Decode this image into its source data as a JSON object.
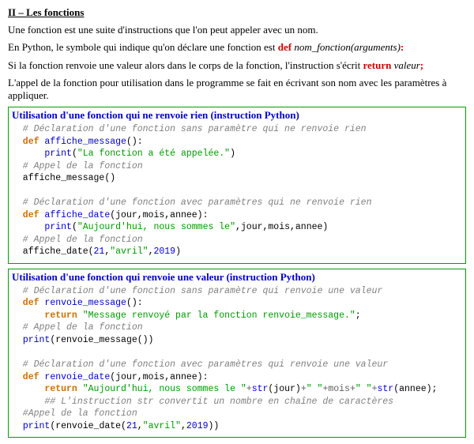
{
  "heading": "II – Les fonctions",
  "para1": "Une fonction est une suite d'instructions que l'on peut appeler avec un nom.",
  "para2_pre": "En Python, le symbole qui indique qu'on déclare une fonction est ",
  "para2_def": "def",
  "para2_sig": " nom_fonction",
  "para2_args": "(arguments)",
  "para2_colon": ":",
  "para3_pre": "Si la fonction renvoie une valeur alors dans le corps de la fonction, l'instruction s'écrit ",
  "para3_ret": "return",
  "para3_val": " valeur",
  "para3_semi": ";",
  "para4": "L'appel de la fonction pour utilisation dans le programme se fait en écrivant son nom avec les paramètres à appliquer.",
  "box1": {
    "title": "Utilisation d'une fonction qui ne renvoie rien (instruction Python)",
    "c1": "  # Déclaration d'une fonction sans paramètre qui ne renvoie rien",
    "l2_def": "  def ",
    "l2_name": "affiche_message",
    "l2_rest": "():",
    "l3_ind": "      ",
    "l3_fn": "print",
    "l3_op": "(",
    "l3_str": "\"La fonction a été appelée.\"",
    "l3_cl": ")",
    "c4": "  # Appel de la fonction",
    "l5": "  affiche_message()",
    "blank1": "",
    "c6": "  # Déclaration d'une fonction avec paramètres qui ne renvoie rien",
    "l7_def": "  def ",
    "l7_name": "affiche_date",
    "l7_rest": "(jour,mois,annee):",
    "l8_ind": "      ",
    "l8_fn": "print",
    "l8_op": "(",
    "l8_str": "\"Aujourd'hui, nous sommes le\"",
    "l8_mid": ",jour,mois,annee)",
    "c9": "  # Appel de la fonction",
    "l10_a": "  affiche_date(",
    "l10_n1": "21",
    "l10_b": ",",
    "l10_s": "\"avril\"",
    "l10_c": ",",
    "l10_n2": "2019",
    "l10_d": ")"
  },
  "box2": {
    "title": "Utilisation d'une fonction qui renvoie une valeur (instruction Python)",
    "c1": "  # Déclaration d'une fonction sans paramètre qui renvoie une valeur",
    "l2_def": "  def ",
    "l2_name": "renvoie_message",
    "l2_rest": "():",
    "l3_ind": "      ",
    "l3_ret": "return ",
    "l3_str": "\"Message renvoyé par la fonction renvoie_message.\"",
    "l3_semi": ";",
    "c4": "  # Appel de la fonction",
    "l5_a": "  ",
    "l5_fn": "print",
    "l5_b": "(renvoie_message())",
    "blank1": "",
    "c6": "  # Déclaration d'une fonction avec paramètres qui renvoie une valeur",
    "l7_def": "  def ",
    "l7_name": "renvoie_date",
    "l7_rest": "(jour,mois,annee):",
    "l8_ind": "      ",
    "l8_ret": "return ",
    "l8_s1": "\"Aujourd'hui, nous sommes le \"",
    "l8_p1": "+",
    "l8_str1": "str",
    "l8_a1": "(jour)",
    "l8_p2": "+",
    "l8_s2": "\" \"",
    "l8_p3": "+mois+",
    "l8_s3": "\" \"",
    "l8_p4": "+",
    "l8_str2": "str",
    "l8_a2": "(annee);",
    "c9": "      ## L'instruction str convertit un nombre en chaîne de caractères",
    "c10": "  #Appel de la fonction",
    "l11_a": "  ",
    "l11_fn": "print",
    "l11_b": "(renvoie_date(",
    "l11_n1": "21",
    "l11_c": ",",
    "l11_s": "\"avril\"",
    "l11_d": ",",
    "l11_n2": "2019",
    "l11_e": "))"
  }
}
